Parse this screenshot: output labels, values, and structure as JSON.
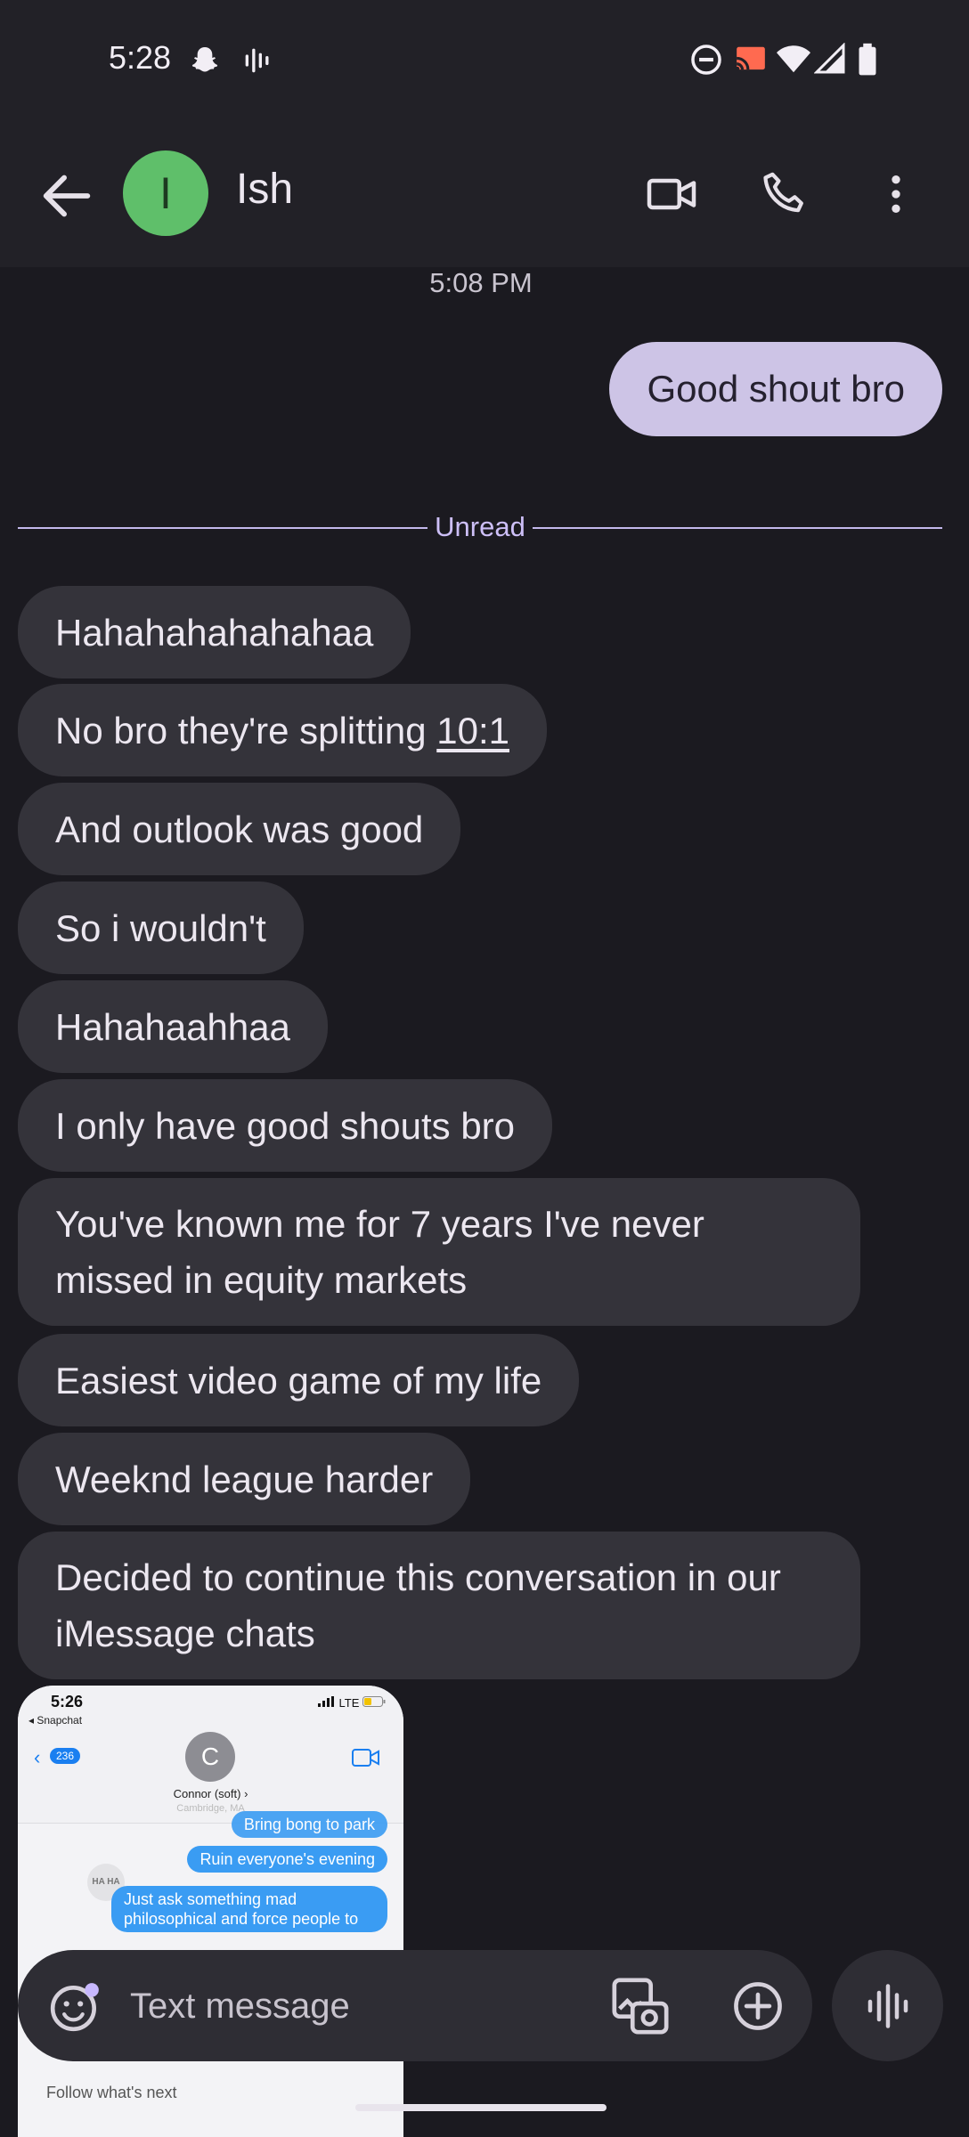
{
  "status_bar": {
    "time": "5:28",
    "icons": [
      "snapchat-icon",
      "audio-wave-icon",
      "dnd-icon",
      "cast-icon",
      "wifi-icon",
      "signal-icon",
      "battery-icon"
    ]
  },
  "header": {
    "avatar_letter": "I",
    "contact_name": "Ish",
    "avatar_color": "#5fbf6a",
    "actions": [
      "video-call-icon",
      "phone-icon",
      "more-vert-icon"
    ]
  },
  "conversation": {
    "timestamp": "5:08 PM",
    "outgoing": [
      {
        "text": "Good shout bro"
      }
    ],
    "unread_label": "Unread",
    "incoming": [
      {
        "text": "Hahahahahahahaa"
      },
      {
        "text_before": "No bro they're splitting ",
        "link": "10:1"
      },
      {
        "text": "And outlook was good"
      },
      {
        "text": "So i wouldn't"
      },
      {
        "text": "Hahahaahhaa"
      },
      {
        "text": "I only have good shouts bro"
      },
      {
        "text": "You've known me for 7 years I've never missed in equity markets"
      },
      {
        "text": "Easiest video game of my life"
      },
      {
        "text": "Weeknd league harder"
      },
      {
        "text": "Decided to continue this conversation in our iMessage chats"
      }
    ],
    "attachment": {
      "time": "5:26",
      "back_app": "◂ Snapchat",
      "status": "LTE",
      "badge": "236",
      "contact_initial": "C",
      "contact_name": "Connor (soft) ›",
      "location": "Cambridge, MA",
      "bubbles": [
        "Bring bong to park",
        "Ruin everyone's evening",
        "Just ask something mad philosophical and force people to"
      ],
      "reaction": "HA HA",
      "behind_text": "Follow what's next"
    }
  },
  "compose": {
    "placeholder": "Text message",
    "value": ""
  },
  "colors": {
    "background": "#1b1a20",
    "incoming_bubble": "#34333a",
    "outgoing_bubble": "#cdc4e6",
    "unread_accent": "#c3b8ec"
  }
}
